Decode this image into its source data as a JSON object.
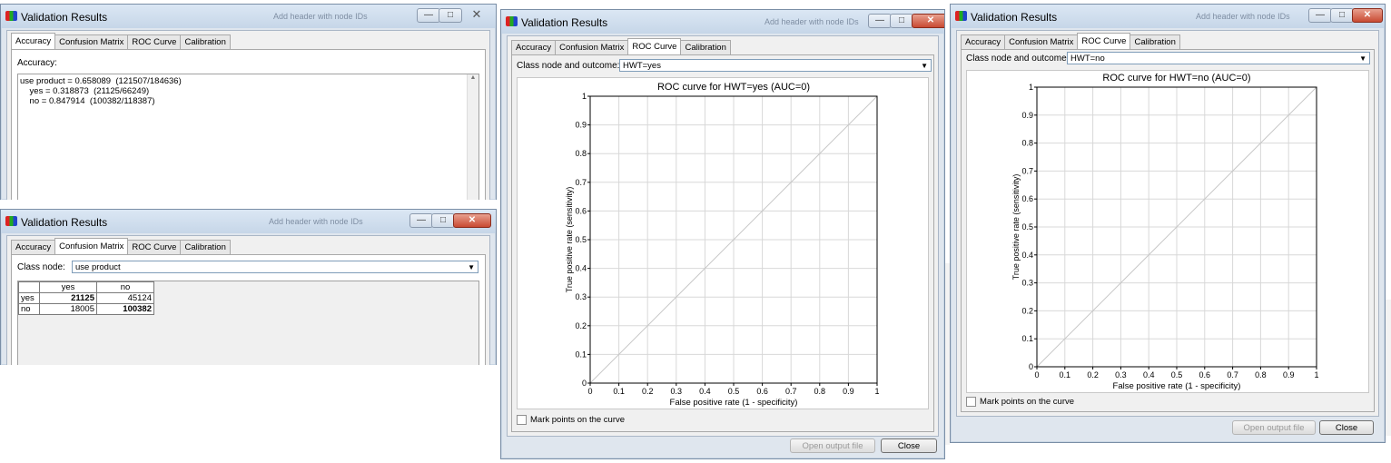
{
  "win_acc": {
    "title": "Validation Results",
    "ghost": "Add header with node IDs",
    "tabs": [
      "Accuracy",
      "Confusion Matrix",
      "ROC Curve",
      "Calibration"
    ],
    "heading": "Accuracy:",
    "lines": [
      "use product = 0.658089  (121507/184636)",
      "    yes = 0.318873  (21125/66249)",
      "    no = 0.847914  (100382/118387)"
    ]
  },
  "win_cm": {
    "title": "Validation Results",
    "ghost": "Add header with node IDs",
    "tabs": [
      "Accuracy",
      "Confusion Matrix",
      "ROC Curve",
      "Calibration"
    ],
    "class_node_label": "Class node:",
    "class_node_value": "use product",
    "columns": [
      "yes",
      "no"
    ],
    "rows": [
      {
        "label": "yes",
        "values": [
          "21125",
          "45124"
        ]
      },
      {
        "label": "no",
        "values": [
          "18005",
          "100382"
        ]
      }
    ]
  },
  "win_roc1": {
    "title": "Validation Results",
    "ghost": "Add header with node IDs",
    "tabs": [
      "Accuracy",
      "Confusion Matrix",
      "ROC Curve",
      "Calibration"
    ],
    "class_label": "Class node and outcome:",
    "class_value": "HWT=yes",
    "mark_points": "Mark points on the curve",
    "open_output": "Open output file",
    "close": "Close"
  },
  "win_roc2": {
    "title": "Validation Results",
    "ghost": "Add header with node IDs",
    "tabs": [
      "Accuracy",
      "Confusion Matrix",
      "ROC Curve",
      "Calibration"
    ],
    "class_label": "Class node and outcome:",
    "class_value": "HWT=no",
    "mark_points": "Mark points on the curve",
    "open_output": "Open output file",
    "close": "Close"
  },
  "chart_data": [
    {
      "type": "line",
      "title": "ROC curve for HWT=yes (AUC=0)",
      "xlabel": "False positive rate (1 - specificity)",
      "ylabel": "True positive rate (sensitivity)",
      "xlim": [
        0,
        1
      ],
      "ylim": [
        0,
        1
      ],
      "ticks": [
        "0",
        "0.1",
        "0.2",
        "0.3",
        "0.4",
        "0.5",
        "0.6",
        "0.7",
        "0.8",
        "0.9",
        "1"
      ],
      "grid": true,
      "series": [
        {
          "x": [
            0,
            1
          ],
          "y": [
            0,
            1
          ]
        }
      ]
    },
    {
      "type": "line",
      "title": "ROC curve for HWT=no (AUC=0)",
      "xlabel": "False positive rate (1 - specificity)",
      "ylabel": "True positive rate (sensitivity)",
      "xlim": [
        0,
        1
      ],
      "ylim": [
        0,
        1
      ],
      "ticks": [
        "0",
        "0.1",
        "0.2",
        "0.3",
        "0.4",
        "0.5",
        "0.6",
        "0.7",
        "0.8",
        "0.9",
        "1"
      ],
      "grid": true,
      "series": [
        {
          "x": [
            0,
            1
          ],
          "y": [
            0,
            1
          ]
        }
      ]
    }
  ]
}
